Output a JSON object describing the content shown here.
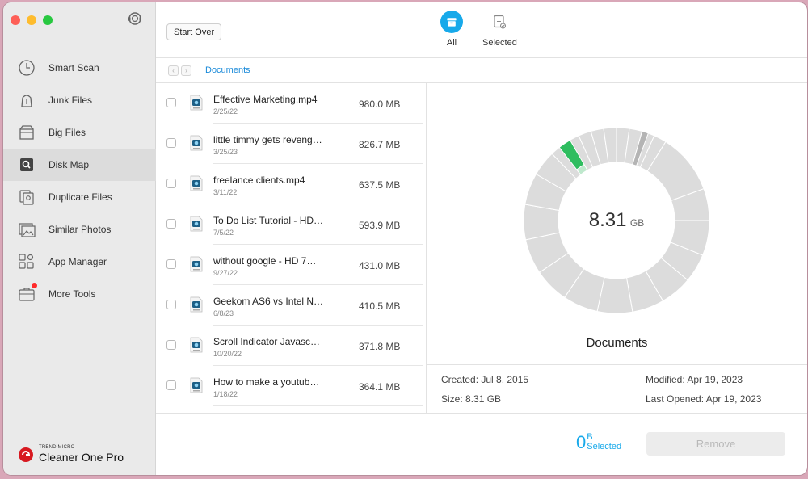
{
  "sidebar": {
    "items": [
      {
        "label": "Smart Scan",
        "icon": "clock-scan-icon",
        "name": "sidebar-item-smart-scan"
      },
      {
        "label": "Junk Files",
        "icon": "trash-bag-icon",
        "name": "sidebar-item-junk-files"
      },
      {
        "label": "Big Files",
        "icon": "box-icon",
        "name": "sidebar-item-big-files"
      },
      {
        "label": "Disk Map",
        "icon": "disk-map-icon",
        "name": "sidebar-item-disk-map",
        "active": true
      },
      {
        "label": "Duplicate Files",
        "icon": "duplicate-icon",
        "name": "sidebar-item-duplicate-files"
      },
      {
        "label": "Similar Photos",
        "icon": "photos-icon",
        "name": "sidebar-item-similar-photos"
      },
      {
        "label": "App Manager",
        "icon": "app-grid-icon",
        "name": "sidebar-item-app-manager"
      },
      {
        "label": "More Tools",
        "icon": "toolbox-icon",
        "name": "sidebar-item-more-tools",
        "badge": true
      }
    ],
    "brand_small": "TREND MICRO",
    "brand_big": "Cleaner One Pro"
  },
  "toolbar": {
    "start_over": "Start Over",
    "tab_all": "All",
    "tab_selected": "Selected"
  },
  "breadcrumb": {
    "back": "‹",
    "forward": "›",
    "current": "Documents"
  },
  "files": [
    {
      "name": "Effective Marketing.mp4",
      "date": "2/25/22",
      "size": "980.0 MB"
    },
    {
      "name": "little timmy gets reveng…",
      "date": "3/25/23",
      "size": "826.7 MB"
    },
    {
      "name": "freelance clients.mp4",
      "date": "3/11/22",
      "size": "637.5 MB"
    },
    {
      "name": "To Do List Tutorial - HD…",
      "date": "7/5/22",
      "size": "593.9 MB"
    },
    {
      "name": "without google - HD 7…",
      "date": "9/27/22",
      "size": "431.0 MB"
    },
    {
      "name": "Geekom AS6 vs Intel N…",
      "date": "6/8/23",
      "size": "410.5 MB"
    },
    {
      "name": "Scroll Indicator Javasc…",
      "date": "10/20/22",
      "size": "371.8 MB"
    },
    {
      "name": "How to make a youtub…",
      "date": "1/18/22",
      "size": "364.1 MB"
    }
  ],
  "detail": {
    "size_value": "8.31",
    "size_unit": "GB",
    "folder_name": "Documents",
    "created": "Created: Jul 8, 2015",
    "size": "Size: 8.31 GB",
    "modified": "Modified: Apr 19, 2023",
    "last_opened": "Last Opened: Apr 19, 2023"
  },
  "footer": {
    "count": "0",
    "unit": "B",
    "selected_label": "Selected",
    "remove": "Remove"
  },
  "colors": {
    "accent": "#17a9ea",
    "highlight_segment": "#2ebd5f",
    "dark_segment": "#b4b4b4",
    "segment": "#dcdcdc"
  }
}
